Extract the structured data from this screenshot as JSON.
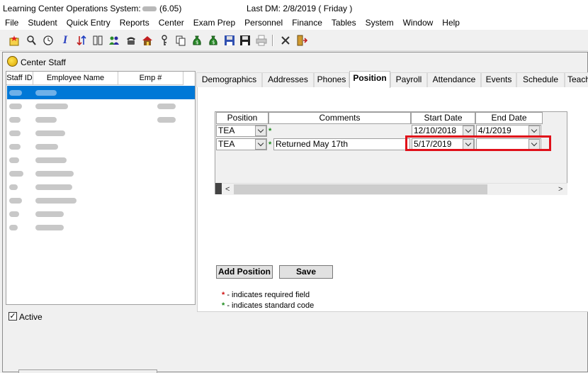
{
  "titlebar": {
    "app_title": "Learning Center Operations System:",
    "version": "(6.05)",
    "last_dm": "Last DM: 2/8/2019  ( Friday )"
  },
  "menu": [
    "File",
    "Student",
    "Quick Entry",
    "Reports",
    "Center",
    "Exam Prep",
    "Personnel",
    "Finance",
    "Tables",
    "System",
    "Window",
    "Help"
  ],
  "toolbar_icons": [
    "new-record-icon",
    "search-person-icon",
    "clock-icon",
    "italic-info-icon",
    "transfer-icon",
    "book-icon",
    "people-icon",
    "phone-icon",
    "house-icon",
    "key-icon",
    "copy-icon",
    "money-bag-icon",
    "save-icon",
    "save-close-icon",
    "print-icon",
    "delete-icon",
    "exit-icon"
  ],
  "window": {
    "title": "Center Staff",
    "icon_text": "LCO"
  },
  "staff_list": {
    "headers": {
      "id": "Staff ID",
      "name": "Employee Name",
      "emp": "Emp #"
    }
  },
  "active_label": "Active",
  "active_mark": "✓",
  "tabs": [
    "Demographics",
    "Addresses",
    "Phones",
    "Position",
    "Payroll",
    "Attendance",
    "Events",
    "Schedule",
    "Teach"
  ],
  "active_tab": "Position",
  "grid": {
    "headers": {
      "position": "Position",
      "comments": "Comments",
      "start": "Start Date",
      "end": "End Date"
    },
    "rows": [
      {
        "position": "TEA",
        "star": "*",
        "comment": "",
        "start": "12/10/2018",
        "end": "4/1/2019"
      },
      {
        "position": "TEA",
        "star": "*",
        "comment": "Returned May 17th",
        "start": "5/17/2019",
        "end": ""
      }
    ],
    "scroll_left": "<",
    "scroll_right": ">"
  },
  "buttons": {
    "add_position": "Add Position",
    "save": "Save"
  },
  "legend": {
    "required_star": "*",
    "required_text": " - indicates required field",
    "standard_star": "*",
    "standard_text": " - indicates standard code"
  },
  "colors": {
    "selection": "#0078d7",
    "highlight_box": "#e0101a",
    "required_star": "#d01010",
    "standard_star": "#1b8a1b"
  }
}
